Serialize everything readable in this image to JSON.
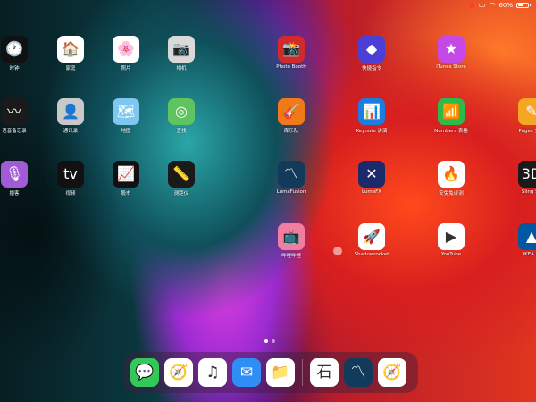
{
  "status_bar": {
    "icons": [
      "record-icon",
      "screen-mirror-icon",
      "wifi-icon"
    ],
    "battery": "60%",
    "battery_level": 0.6
  },
  "apps": [
    {
      "id": "clock",
      "label": "时钟",
      "icon": "clock-icon",
      "glyph": "🕐",
      "bg": "#111111",
      "col": 0,
      "row": 0
    },
    {
      "id": "home",
      "label": "家庭",
      "icon": "house-icon",
      "glyph": "🏠",
      "bg": "#ffffff",
      "col": 1,
      "row": 0
    },
    {
      "id": "photos",
      "label": "照片",
      "icon": "photos-icon",
      "glyph": "🌸",
      "bg": "#ffffff",
      "col": 2,
      "row": 0
    },
    {
      "id": "camera",
      "label": "相机",
      "icon": "camera-icon",
      "glyph": "📷",
      "bg": "#d9d9d9",
      "col": 3,
      "row": 0
    },
    {
      "id": "voice-memos",
      "label": "语音备忘录",
      "icon": "waveform-icon",
      "glyph": "〰",
      "bg": "#1a1a1a",
      "col": 0,
      "row": 1
    },
    {
      "id": "contacts",
      "label": "通讯录",
      "icon": "contacts-icon",
      "glyph": "👤",
      "bg": "#c9c9c9",
      "col": 1,
      "row": 1
    },
    {
      "id": "maps",
      "label": "地图",
      "icon": "maps-icon",
      "glyph": "🗺",
      "bg": "#7ec7f0",
      "col": 2,
      "row": 1
    },
    {
      "id": "find-my",
      "label": "查找",
      "icon": "find-my-icon",
      "glyph": "◎",
      "bg": "#5fc35f",
      "col": 3,
      "row": 1
    },
    {
      "id": "podcasts",
      "label": "播客",
      "icon": "podcasts-icon",
      "glyph": "🎙",
      "bg": "#a25ad6",
      "col": 0,
      "row": 2
    },
    {
      "id": "tv",
      "label": "视频",
      "icon": "apple-tv-icon",
      "glyph": "tv",
      "bg": "#111111",
      "col": 1,
      "row": 2
    },
    {
      "id": "stocks",
      "label": "股市",
      "icon": "stocks-icon",
      "glyph": "📈",
      "bg": "#111111",
      "col": 2,
      "row": 2
    },
    {
      "id": "measure",
      "label": "测距仪",
      "icon": "ruler-icon",
      "glyph": "📏",
      "bg": "#1a1a1a",
      "col": 3,
      "row": 2
    },
    {
      "id": "photo-booth",
      "label": "Photo Booth",
      "icon": "photo-booth-icon",
      "glyph": "📸",
      "bg": "#d22a2a",
      "col": 4,
      "row": 0
    },
    {
      "id": "shortcuts",
      "label": "快捷指令",
      "icon": "shortcuts-icon",
      "glyph": "◆",
      "bg": "#4b3fd6",
      "col": 5,
      "row": 0
    },
    {
      "id": "itunes-store",
      "label": "iTunes Store",
      "icon": "star-icon",
      "glyph": "★",
      "bg": "#c648e6",
      "col": 6,
      "row": 0
    },
    {
      "id": "garageband",
      "label": "库乐队",
      "icon": "guitar-icon",
      "glyph": "🎸",
      "bg": "#f07a1a",
      "col": 4,
      "row": 1
    },
    {
      "id": "keynote",
      "label": "Keynote 讲演",
      "icon": "keynote-icon",
      "glyph": "📊",
      "bg": "#1e7be0",
      "col": 5,
      "row": 1
    },
    {
      "id": "numbers",
      "label": "Numbers 表格",
      "icon": "numbers-icon",
      "glyph": "📶",
      "bg": "#2fb94a",
      "col": 6,
      "row": 1
    },
    {
      "id": "lumafusion",
      "label": "LumaFusion",
      "icon": "lumafusion-icon",
      "glyph": "〽",
      "bg": "#123a5a",
      "col": 4,
      "row": 2
    },
    {
      "id": "lumafx",
      "label": "LumaFX",
      "icon": "lumafx-icon",
      "glyph": "✕",
      "bg": "#1b2a6a",
      "col": 5,
      "row": 2
    },
    {
      "id": "antutu",
      "label": "安兔兔评测",
      "icon": "antutu-icon",
      "glyph": "🔥",
      "bg": "#ffffff",
      "col": 6,
      "row": 2
    },
    {
      "id": "bilibili",
      "label": "哔哩哔哩",
      "icon": "bilibili-icon",
      "glyph": "📺",
      "bg": "#f27da0",
      "col": 4,
      "row": 3
    },
    {
      "id": "shadowrocket",
      "label": "Shadowrocket",
      "icon": "rocket-icon",
      "glyph": "🚀",
      "bg": "#ffffff",
      "col": 5,
      "row": 3
    },
    {
      "id": "youtube",
      "label": "YouTube",
      "icon": "youtube-icon",
      "glyph": "▶",
      "bg": "#ffffff",
      "col": 6,
      "row": 3
    },
    {
      "id": "pages",
      "label": "Pages 文稿",
      "icon": "pages-icon",
      "glyph": "✎",
      "bg": "#f5a623",
      "col": 7,
      "row": 1
    },
    {
      "id": "3dmark",
      "label": "Sling Sh",
      "icon": "3dmark-icon",
      "glyph": "3D",
      "bg": "#1a1a1a",
      "col": 7,
      "row": 2
    },
    {
      "id": "ikea",
      "label": "IKEA Pl",
      "icon": "ikea-icon",
      "glyph": "▲",
      "bg": "#0058a3",
      "col": 7,
      "row": 3
    }
  ],
  "dock": [
    {
      "id": "messages",
      "icon": "messages-icon",
      "glyph": "💬",
      "bg": "#34c759"
    },
    {
      "id": "safari",
      "icon": "safari-icon",
      "glyph": "🧭",
      "bg": "#ffffff"
    },
    {
      "id": "music",
      "icon": "music-icon",
      "glyph": "♫",
      "bg": "#ffffff"
    },
    {
      "id": "mail",
      "icon": "mail-icon",
      "glyph": "✉",
      "bg": "#2f8ef5"
    },
    {
      "id": "files",
      "icon": "folder-icon",
      "glyph": "📁",
      "bg": "#ffffff"
    },
    {
      "id": "dictionary",
      "icon": "stone-dictionary-icon",
      "glyph": "石",
      "bg": "#ffffff",
      "recent": true
    },
    {
      "id": "lumafusion-recent",
      "icon": "lumafusion-icon",
      "glyph": "〽",
      "bg": "#123a5a",
      "recent": true
    },
    {
      "id": "safari-recent",
      "icon": "safari-icon",
      "glyph": "🧭",
      "bg": "#ffffff",
      "recent": true
    }
  ],
  "page_indicator": {
    "count": 2,
    "active": 0
  }
}
